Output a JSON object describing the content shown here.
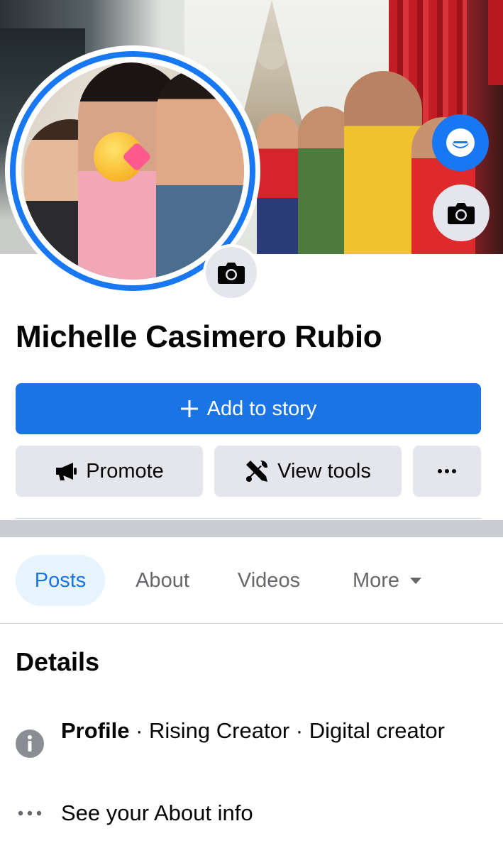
{
  "profile": {
    "name": "Michelle Casimero Rubio"
  },
  "actions": {
    "add_story": "Add to story",
    "promote": "Promote",
    "view_tools": "View tools",
    "more_glyph": "•••"
  },
  "tabs": [
    {
      "label": "Posts",
      "active": true
    },
    {
      "label": "About",
      "active": false
    },
    {
      "label": "Videos",
      "active": false
    },
    {
      "label": "More",
      "active": false
    }
  ],
  "details": {
    "title": "Details",
    "profile_label": "Profile",
    "profile_rest": " · Rising Creator · Digital creator",
    "about_link": "See your About info"
  },
  "colors": {
    "primary": "#1b74e4",
    "button_gray": "#e4e6eb",
    "tab_active_bg": "#e7f3ff",
    "muted_text": "#65676b"
  },
  "icons": [
    "messenger-icon",
    "camera-icon",
    "plus-icon",
    "megaphone-icon",
    "tools-icon",
    "more-dots-icon",
    "caret-down-icon",
    "info-icon"
  ]
}
